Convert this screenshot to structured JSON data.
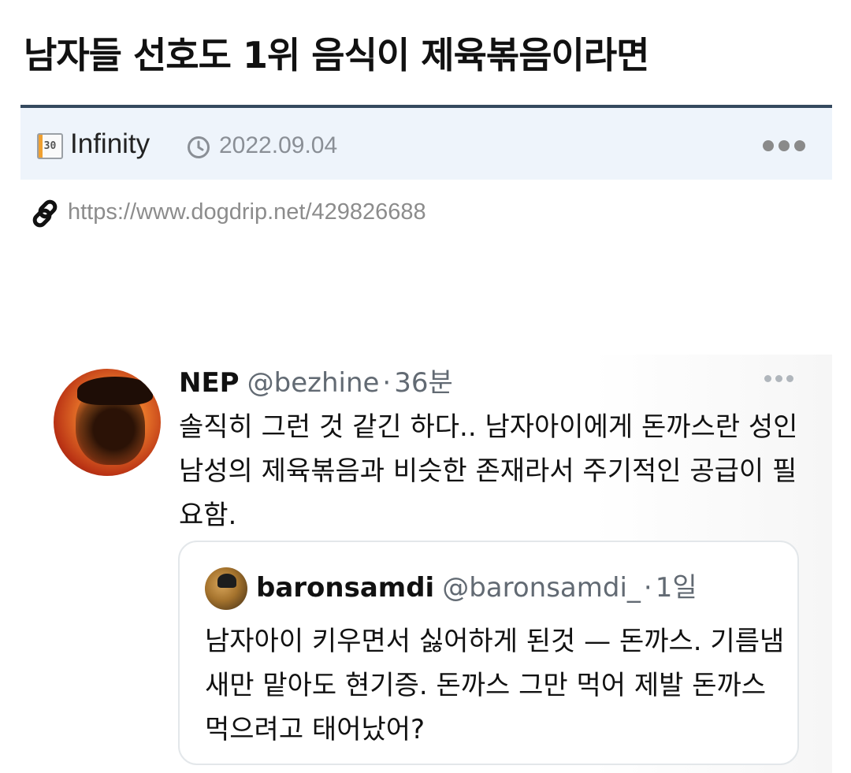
{
  "post": {
    "title": "남자들 선호도 1위 음식이 제육볶음이라면",
    "level_badge": "30",
    "author": "Infinity",
    "date": "2022.09.04",
    "url": "https://www.dogdrip.net/429826688"
  },
  "tweet": {
    "name": "NEP",
    "handle": "@bezhine",
    "separator": "·",
    "time": "36분",
    "text": "솔직히 그런 것 같긴 하다.. 남자아이에게 돈까스란 성인 남성의 제육볶음과 비슷한 존재라서 주기적인 공급이 필요함."
  },
  "quoted_tweet": {
    "name": "baronsamdi",
    "handle": "@baronsamdi_",
    "separator": "·",
    "time": "1일",
    "text": "남자아이 키우면서 싫어하게 된것 — 돈까스. 기름냄새만 맡아도 현기증. 돈까스 그만 먹어 제발 돈까스 먹으려고 태어났어?"
  },
  "colors": {
    "meta_bar_bg": "#eef4fb",
    "meta_bar_border": "#34495e",
    "muted_text": "#8a8f96",
    "handle_text": "#626a73"
  },
  "icons": {
    "clock": "clock-icon",
    "link": "link-icon",
    "more": "more-dots-icon"
  }
}
